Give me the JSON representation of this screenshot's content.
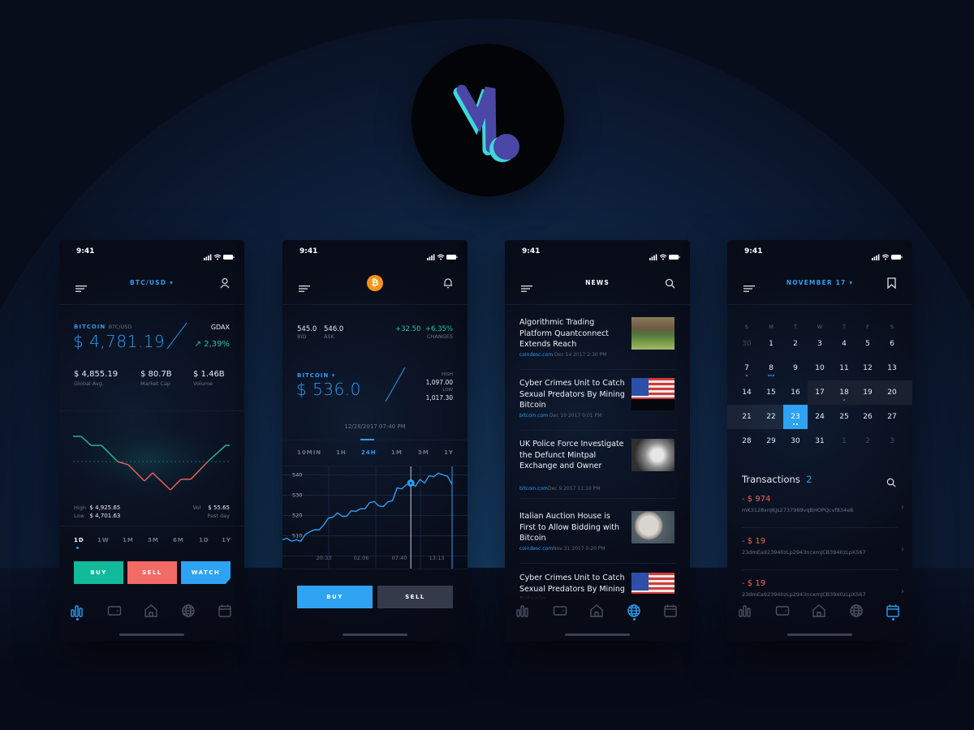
{
  "colors": {
    "accent": "#2a9df4",
    "up": "#1fc79a",
    "down": "#f2615c",
    "buy": "#12b99a",
    "sell": "#f26b65",
    "watch": "#2ea3f2",
    "logo_purple": "#4b47a6",
    "logo_cyan": "#3fd6dc"
  },
  "status_time": "9:41",
  "nav_icons": [
    "bar-chart-icon",
    "wallet-icon",
    "home-icon",
    "globe-icon",
    "calendar-icon"
  ],
  "screen1": {
    "pair_selector": "BTC/USD",
    "coin_label": "BITCOIN",
    "coin_pair": "BTC/USD",
    "price": "$ 4,781.19",
    "exchange": "GDAX",
    "change": "2,39%",
    "stats": [
      {
        "value": "$ 4,855.19",
        "label": "Global Avg."
      },
      {
        "value": "$ 80.7B",
        "label": "Market Cap"
      },
      {
        "value": "$ 1.46B",
        "label": "Volume"
      }
    ],
    "high_label": "High",
    "high": "$ 4,925.65",
    "low_label": "Low",
    "low": "$ 4,701.63",
    "vol_label": "Vol",
    "vol": "$ 55.65",
    "vol_period": "Past day",
    "sparkline": [
      4925.65,
      4925.65,
      4888,
      4888,
      4820,
      4807,
      4739,
      4773,
      4701.63,
      4746,
      4746,
      4820,
      4888,
      4888
    ],
    "sparkline_reference": 4820,
    "ranges": [
      "1D",
      "1W",
      "1M",
      "3M",
      "6M",
      "1D",
      "1Y"
    ],
    "active_range": 0,
    "buy": "BUY",
    "sell": "SELL",
    "watch": "WATCH",
    "active_nav": 0
  },
  "screen2": {
    "bid": "545.0",
    "bid_label": "BID",
    "ask": "546.0",
    "ask_label": "ASK",
    "change_abs": "+32.50",
    "change_pct": "+6.35%",
    "changes_label": "CHANGES",
    "coin_label": "BITCOIN",
    "price": "$ 536.0",
    "high_label": "HIGH",
    "high": "1,097.00",
    "low_label": "LOW",
    "low": "1,017.30",
    "timestamp": "12/28/2017 07:40 PM",
    "ranges": [
      "10MIN",
      "1H",
      "24H",
      "1M",
      "3M",
      "1Y"
    ],
    "active_range": 2,
    "buy": "BUY",
    "sell": "SELL",
    "chart_data": {
      "type": "line",
      "y_ticks": [
        510,
        520,
        530,
        540
      ],
      "x_ticks": [
        "20:33",
        "02:06",
        "07:40",
        "13:13"
      ],
      "ylim": [
        503,
        543
      ],
      "values": [
        508,
        508.7,
        507.3,
        508,
        507.3,
        510.7,
        512,
        512.9,
        512.9,
        515.3,
        518.7,
        519.1,
        521.3,
        519.6,
        519.6,
        522.3,
        522,
        523.3,
        523.3,
        526.3,
        526.9,
        524.7,
        524.4,
        526.7,
        527.3,
        533.6,
        533.1,
        535.1,
        536,
        534.4,
        537.7,
        536,
        539.6,
        539.1,
        540.9,
        540,
        539.3,
        535.3
      ],
      "selected_index": 28,
      "grid": true
    }
  },
  "screen3": {
    "title": "NEWS",
    "active_nav": 3,
    "articles": [
      {
        "title": "Algorithmic Trading Platform Quantconnect Extends Reach",
        "source": "coindesc.com",
        "date": " Dec 14 2017 2:30 PM",
        "thumb": "park"
      },
      {
        "title": "Cyber Crimes Unit to Catch Sexual Predators By Mining Bitcoin",
        "source": "bitcoin.com",
        "date": " Dec 10 2017 0:01 PM",
        "thumb": "flag"
      },
      {
        "title": "UK Police Force Investigate the Defunct Mintpal Exchange and Owner",
        "source": "bitcoin.com",
        "date": "Dec 9 2017 11:10 PM",
        "thumb": "portrait"
      },
      {
        "title": "Italian Auction House is First to Allow Bidding with Bitcoin",
        "source": "coindesc.com",
        "date": "Nov 31 2017 0:20 PM",
        "thumb": "coin"
      },
      {
        "title": "Cyber Crimes Unit to Catch Sexual Predators By Mining Bitcoin",
        "source": "",
        "date": "",
        "thumb": "flag"
      }
    ]
  },
  "screen4": {
    "month": "NOVEMBER 17",
    "active_nav": 4,
    "weekdays": [
      "S",
      "M",
      "T",
      "W",
      "T",
      "F",
      "S"
    ],
    "weeks": [
      [
        "30",
        "1",
        "2",
        "3",
        "4",
        "5",
        "6"
      ],
      [
        "7",
        "8",
        "9",
        "10",
        "11",
        "12",
        "13"
      ],
      [
        "14",
        "15",
        "16",
        "17",
        "18",
        "19",
        "20"
      ],
      [
        "21",
        "22",
        "23",
        "24",
        "25",
        "26",
        "27"
      ],
      [
        "28",
        "29",
        "30",
        "31",
        "1",
        "2",
        "3"
      ]
    ],
    "selected_day": "23",
    "transactions_label": "Transactions",
    "transactions_count": "2",
    "transactions": [
      {
        "amount": "- $ 974",
        "hash": "mK3128xnJKJs2737989vqBHOPQcvf834e8"
      },
      {
        "amount": "- $ 19",
        "hash": "23dmEa923940zLp2943ncxmJCB3940zLpX567"
      },
      {
        "amount": "- $ 19",
        "hash": "23dmEa923940zLp2943ncxmJCB3940zLpX567"
      }
    ]
  }
}
